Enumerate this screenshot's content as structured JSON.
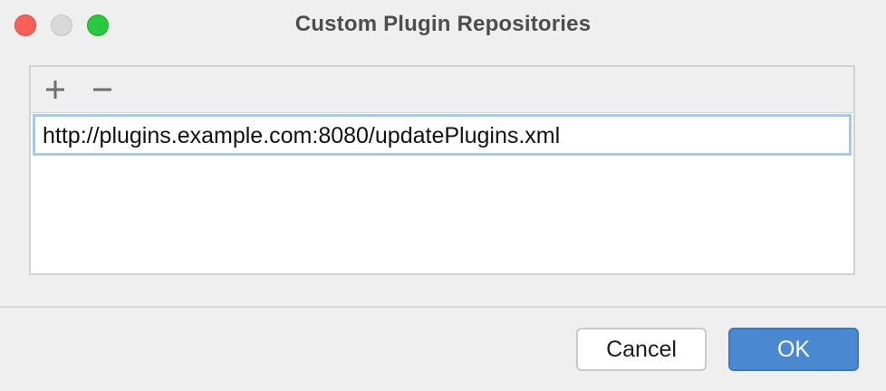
{
  "window": {
    "title": "Custom Plugin Repositories"
  },
  "toolbar": {
    "add_icon": "plus-icon",
    "remove_icon": "minus-icon"
  },
  "repositories": {
    "editing_value": "http://plugins.example.com:8080/updatePlugins.xml"
  },
  "buttons": {
    "cancel_label": "Cancel",
    "ok_label": "OK"
  },
  "colors": {
    "accent": "#4a89cf",
    "focus_ring": "#a6c9ee",
    "close": "#fe5f57",
    "minimize": "#d9d9d9",
    "zoom": "#28c840"
  }
}
